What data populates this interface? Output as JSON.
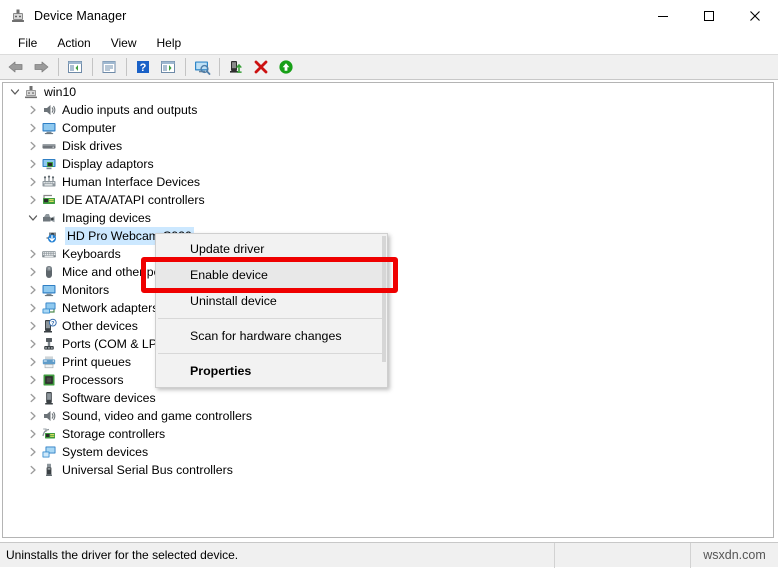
{
  "window": {
    "title": "Device Manager",
    "app_icon": "device-manager-icon",
    "controls": {
      "minimize": "—",
      "maximize": "☐",
      "close": "✕"
    }
  },
  "menubar": {
    "items": [
      {
        "label": "File",
        "name": "menu-file"
      },
      {
        "label": "Action",
        "name": "menu-action"
      },
      {
        "label": "View",
        "name": "menu-view"
      },
      {
        "label": "Help",
        "name": "menu-help"
      }
    ]
  },
  "toolbar": {
    "buttons": [
      {
        "name": "back-button",
        "icon": "back-arrow-icon"
      },
      {
        "name": "forward-button",
        "icon": "forward-arrow-icon"
      },
      {
        "name": "show-hide-console-tree-button",
        "icon": "console-tree-icon"
      },
      {
        "name": "properties-button",
        "icon": "properties-window-icon"
      },
      {
        "name": "help-button",
        "icon": "question-mark-icon"
      },
      {
        "name": "show-hide-action-pane-button",
        "icon": "action-pane-icon"
      },
      {
        "name": "scan-hardware-changes-button",
        "icon": "scan-monitor-icon"
      },
      {
        "name": "update-driver-button",
        "icon": "update-driver-icon"
      },
      {
        "name": "uninstall-device-button",
        "icon": "red-x-icon"
      },
      {
        "name": "enable-device-button",
        "icon": "green-up-arrow-icon"
      }
    ]
  },
  "tree": {
    "root": {
      "label": "win10",
      "icon": "computer-root-icon",
      "expanded": true
    },
    "nodes": [
      {
        "label": "Audio inputs and outputs",
        "icon": "speaker-icon",
        "expanded": false,
        "depth": 1
      },
      {
        "label": "Computer",
        "icon": "monitor-icon",
        "expanded": false,
        "depth": 1
      },
      {
        "label": "Disk drives",
        "icon": "disk-drive-icon",
        "expanded": false,
        "depth": 1
      },
      {
        "label": "Display adaptors",
        "icon": "display-adapter-icon",
        "expanded": false,
        "depth": 1
      },
      {
        "label": "Human Interface Devices",
        "icon": "hid-icon",
        "expanded": false,
        "depth": 1
      },
      {
        "label": "IDE ATA/ATAPI controllers",
        "icon": "ide-controller-icon",
        "expanded": false,
        "depth": 1
      },
      {
        "label": "Imaging devices",
        "icon": "camera-icon",
        "expanded": true,
        "depth": 1
      },
      {
        "label": "HD Pro Webcam C920",
        "icon": "webcam-disabled-icon",
        "expanded": null,
        "depth": 2,
        "selected": true
      },
      {
        "label": "Keyboards",
        "icon": "keyboard-icon",
        "expanded": false,
        "depth": 1
      },
      {
        "label": "Mice and other pointing devices",
        "icon": "mouse-icon",
        "expanded": false,
        "depth": 1
      },
      {
        "label": "Monitors",
        "icon": "monitor-icon",
        "expanded": false,
        "depth": 1
      },
      {
        "label": "Network adapters",
        "icon": "network-adapter-icon",
        "expanded": false,
        "depth": 1
      },
      {
        "label": "Other devices",
        "icon": "unknown-device-icon",
        "expanded": false,
        "depth": 1
      },
      {
        "label": "Ports (COM & LPT)",
        "icon": "port-icon",
        "expanded": false,
        "depth": 1
      },
      {
        "label": "Print queues",
        "icon": "printer-icon",
        "expanded": false,
        "depth": 1
      },
      {
        "label": "Processors",
        "icon": "processor-icon",
        "expanded": false,
        "depth": 1
      },
      {
        "label": "Software devices",
        "icon": "software-device-icon",
        "expanded": false,
        "depth": 1
      },
      {
        "label": "Sound, video and game controllers",
        "icon": "speaker-icon",
        "expanded": false,
        "depth": 1
      },
      {
        "label": "Storage controllers",
        "icon": "storage-controller-icon",
        "expanded": false,
        "depth": 1
      },
      {
        "label": "System devices",
        "icon": "system-device-icon",
        "expanded": false,
        "depth": 1
      },
      {
        "label": "Universal Serial Bus controllers",
        "icon": "usb-icon",
        "expanded": false,
        "depth": 1
      }
    ]
  },
  "context_menu": {
    "items": [
      {
        "label": "Update driver",
        "name": "ctx-update-driver",
        "bold": false,
        "highlighted": false
      },
      {
        "label": "Enable device",
        "name": "ctx-enable-device",
        "bold": false,
        "highlighted": true
      },
      {
        "label": "Uninstall device",
        "name": "ctx-uninstall-device",
        "bold": false,
        "highlighted": false
      },
      {
        "label": "Scan for hardware changes",
        "name": "ctx-scan-hardware-changes",
        "bold": false,
        "highlighted": false
      },
      {
        "label": "Properties",
        "name": "ctx-properties",
        "bold": true,
        "highlighted": false
      }
    ]
  },
  "annotation": {
    "highlight_color": "#ef0000",
    "target": "Enable device"
  },
  "statusbar": {
    "message": "Uninstalls the driver for the selected device.",
    "watermark": "wsxdn.com"
  }
}
